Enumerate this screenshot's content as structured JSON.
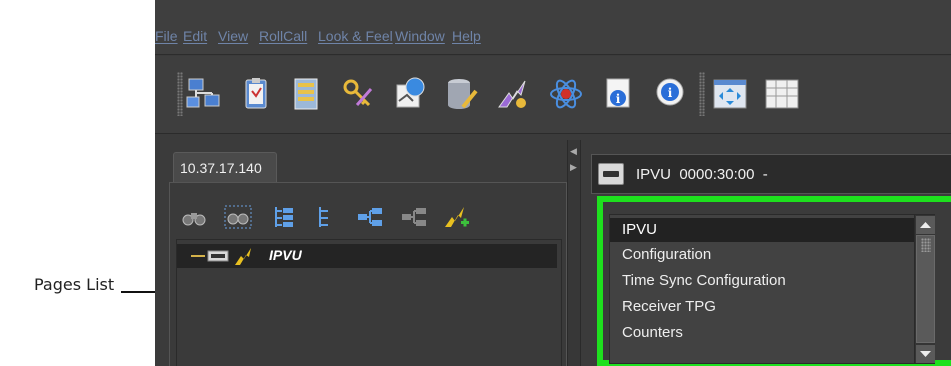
{
  "callout": {
    "label": "Pages List"
  },
  "menu": [
    "File",
    "Edit",
    "View",
    "RollCall",
    "Look & Feel",
    "Window",
    "Help"
  ],
  "toolbar": {
    "icons": [
      "network-icon",
      "clipboard-icon",
      "server-cabinet-icon",
      "keys-icon",
      "globe-pin-icon",
      "database-edit-icon",
      "alarm-lightning-icon",
      "atom-icon",
      "info-document-icon",
      "info-bubble-icon",
      "window-arrows-icon",
      "grid-window-icon"
    ]
  },
  "left_panel": {
    "tab_label": "10.37.17.140",
    "tree_tools": [
      "binoculars-icon",
      "binoculars-select-icon",
      "expand-tree-icon",
      "collapse-tree-icon",
      "connect-nodes-icon",
      "disconnect-nodes-icon",
      "add-alarm-icon"
    ],
    "tree": [
      {
        "label": "IPVU"
      }
    ]
  },
  "right_panel": {
    "title": "IPVU  0000:30:00  -",
    "pages": [
      "IPVU",
      "Configuration",
      "Time Sync Configuration",
      "Receiver TPG",
      "Counters"
    ],
    "selected_index": 0
  },
  "colors": {
    "highlight_border": "#1ee01e",
    "menu_text": "#6f84a8",
    "background": "#3b3b3b"
  }
}
